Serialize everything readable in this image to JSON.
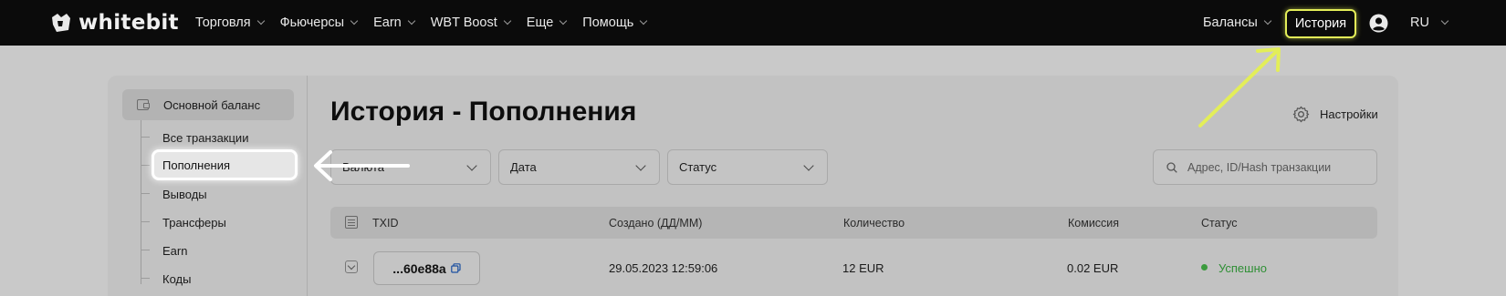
{
  "brand": {
    "name": "whitebit"
  },
  "nav": {
    "items": [
      "Торговля",
      "Фьючерсы",
      "Earn",
      "WBT Boost",
      "Еще",
      "Помощь"
    ]
  },
  "header_right": {
    "balances": "Балансы",
    "history": "История",
    "lang": "RU"
  },
  "sidebar": {
    "main_balance": "Основной баланс",
    "items": [
      "Все транзакции",
      "Пополнения",
      "Выводы",
      "Трансферы",
      "Earn",
      "Коды"
    ],
    "active_index": 1
  },
  "page": {
    "title": "История - Пополнения",
    "settings_label": "Настройки"
  },
  "filters": {
    "currency": "Валюта",
    "date": "Дата",
    "status": "Статус",
    "search_placeholder": "Адрес, ID/Hash транзакции"
  },
  "table": {
    "columns": [
      "TXID",
      "Создано (ДД/ММ)",
      "Количество",
      "Комиссия",
      "Статус"
    ],
    "rows": [
      {
        "txid": "...60e88a",
        "created": "29.05.2023 12:59:06",
        "amount": "12 EUR",
        "fee": "0.02 EUR",
        "status": "Успешно"
      }
    ]
  },
  "colors": {
    "topbar": "#0b0b0b",
    "highlight": "#e3ee58",
    "success": "#2f8f35",
    "overlay_bg": "#c9c9c9"
  },
  "icons": [
    "logo-icon",
    "chevron-down-icon",
    "user-icon",
    "wallet-icon",
    "gear-icon",
    "search-icon",
    "list-icon",
    "expand-icon",
    "copy-icon",
    "arrow-annotation"
  ]
}
